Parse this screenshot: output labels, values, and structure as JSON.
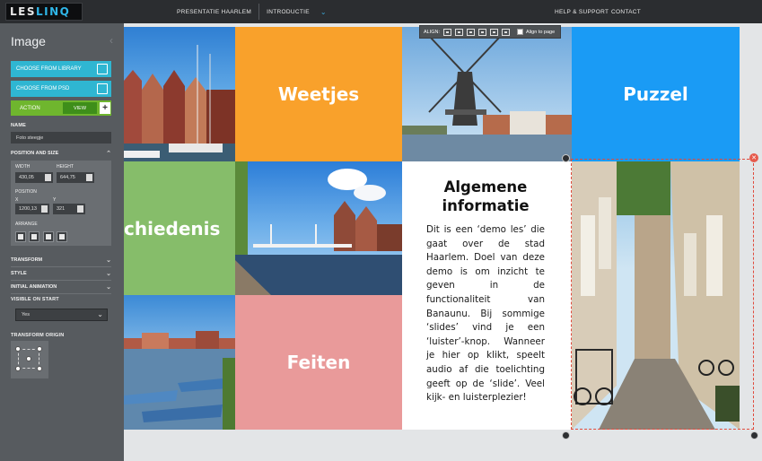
{
  "app": {
    "logo_main": "LES",
    "logo_accent": "LINQ"
  },
  "topnav": {
    "presentation": "PRESENTATIE HAARLEM",
    "section": "INTRODUCTIE",
    "help": "HELP & SUPPORT",
    "contact": "CONTACT"
  },
  "panel": {
    "title": "Image",
    "choose_library": "CHOOSE FROM LIBRARY",
    "choose_psd": "CHOOSE FROM PSD",
    "action": "ACTION",
    "view": "VIEW",
    "plus": "+",
    "name_label": "NAME",
    "name_value": "Foto steegje",
    "position_size_label": "POSITION AND SIZE",
    "width_label": "WIDTH",
    "width_value": "430,05",
    "height_label": "HEIGHT",
    "height_value": "644,75",
    "position_label": "POSITION",
    "x_label": "X",
    "x_value": "1200,13",
    "y_label": "Y",
    "y_value": "321",
    "arrange_label": "ARRANGE",
    "transform_label": "TRANSFORM",
    "style_label": "STYLE",
    "initial_animation_label": "INITIAL ANIMATION",
    "visible_on_start_label": "VISIBLE ON START",
    "visible_value": "Yes",
    "transform_origin_label": "TRANSFORM ORIGIN"
  },
  "align": {
    "label": "ALIGN:",
    "align_to_page": "Align to page"
  },
  "slide": {
    "tile_weetjes": "Weetjes",
    "tile_puzzel": "Puzzel",
    "tile_geschiedenis": "chiedenis",
    "tile_feiten": "Feiten",
    "info_title": "Algemene informatie",
    "info_body": "Dit is een ‘demo les’ die gaat over de stad Haarlem. Doel van deze demo is om inzicht te geven in de functionaliteit van Banaunu. Bij sommige ‘slides’ vind je een ‘luister’-knop. Wanneer je hier op klikt, speelt audio af die toelichting geeft op de ‘slide’. Veel kijk- en luisterplezier!"
  },
  "colors": {
    "orange": "#f9a12b",
    "blue": "#1a9bf5",
    "green": "#86bd6a",
    "pink": "#e99a9a",
    "panel": "#575b5f",
    "accent": "#2fb6d2",
    "action_green": "#6fb62e"
  }
}
